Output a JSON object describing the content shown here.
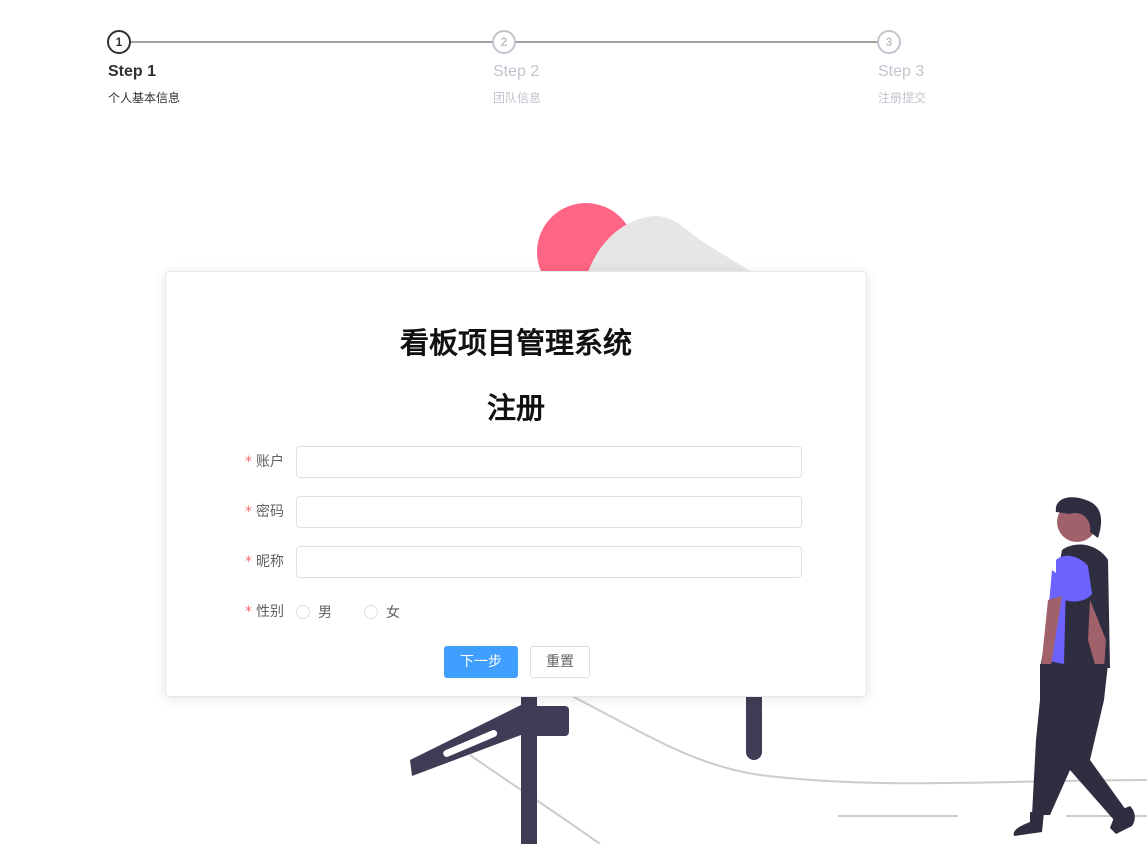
{
  "steps": [
    {
      "number": "1",
      "title": "Step 1",
      "description": "个人基本信息",
      "active": true
    },
    {
      "number": "2",
      "title": "Step 2",
      "description": "团队信息",
      "active": false
    },
    {
      "number": "3",
      "title": "Step 3",
      "description": "注册提交",
      "active": false
    }
  ],
  "form": {
    "app_title": "看板项目管理系统",
    "heading": "注册",
    "required_mark": "*",
    "account_label": "账户",
    "account_value": "",
    "password_label": "密码",
    "password_value": "",
    "nickname_label": "昵称",
    "nickname_value": "",
    "gender_label": "性别",
    "gender_options": [
      "男",
      "女"
    ],
    "next_button": "下一步",
    "reset_button": "重置"
  },
  "colors": {
    "primary": "#409eff",
    "required": "#f56c6c",
    "sun": "#ff6584",
    "figure_dark": "#2f2e41",
    "figure_accent": "#6c63ff"
  }
}
